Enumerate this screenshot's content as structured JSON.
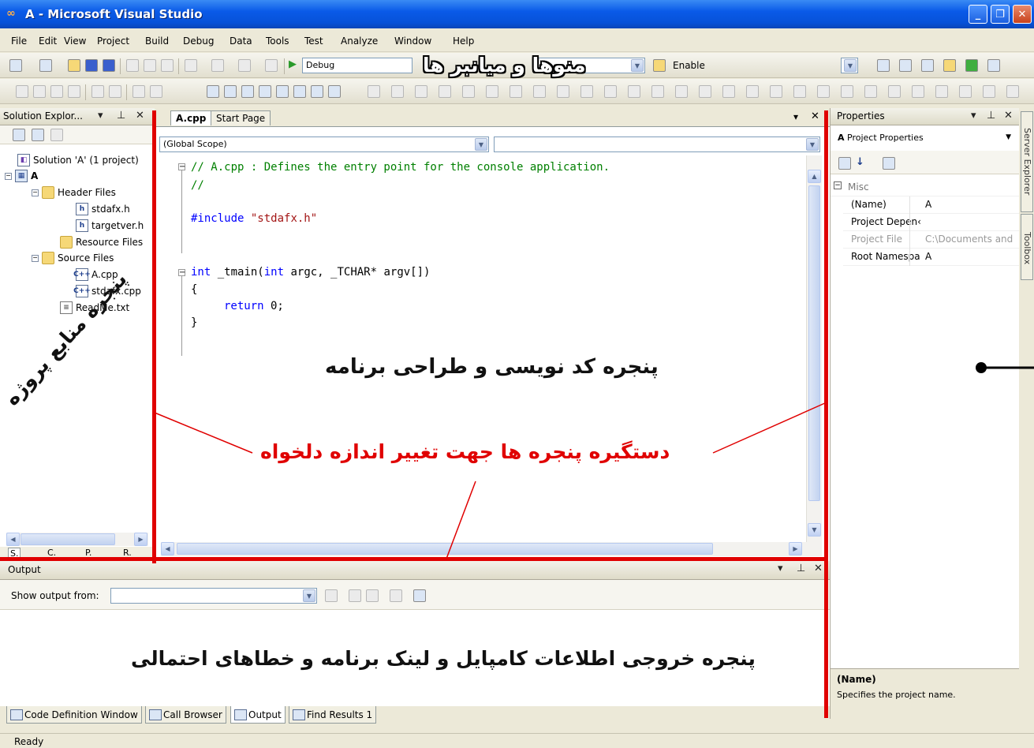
{
  "window": {
    "title": "A - Microsoft Visual Studio"
  },
  "menu": [
    "File",
    "Edit",
    "View",
    "Project",
    "Build",
    "Debug",
    "Data",
    "Tools",
    "Test",
    "Analyze",
    "Window",
    "Help"
  ],
  "toolbar": {
    "config_label": "Debug",
    "enable_label": "Enable"
  },
  "solution_explorer": {
    "title": "Solution Explor...",
    "tree": [
      {
        "label": "Solution 'A' (1 project)",
        "icon": "solution-icon",
        "level": 0
      },
      {
        "label": "A",
        "icon": "project-icon",
        "level": 0
      },
      {
        "label": "Header Files",
        "icon": "folder-icon",
        "level": 1
      },
      {
        "label": "stdafx.h",
        "icon": "header-file-icon",
        "level": 2
      },
      {
        "label": "targetver.h",
        "icon": "header-file-icon",
        "level": 2
      },
      {
        "label": "Resource Files",
        "icon": "folder-icon",
        "level": 1
      },
      {
        "label": "Source Files",
        "icon": "folder-icon",
        "level": 1
      },
      {
        "label": "A.cpp",
        "icon": "cpp-file-icon",
        "level": 2
      },
      {
        "label": "stdafx.cpp",
        "icon": "cpp-file-icon",
        "level": 2
      },
      {
        "label": "ReadMe.txt",
        "icon": "text-file-icon",
        "level": 1
      }
    ],
    "bottom_tabs": [
      "S.",
      "C.",
      "P.",
      "R."
    ]
  },
  "editor": {
    "tabs": [
      "A.cpp",
      "Start Page"
    ],
    "scope": "(Global Scope)",
    "member": "",
    "code": {
      "line1": "// A.cpp : Defines the entry point for the console application.",
      "line2": "//",
      "include_kw": "#include",
      "include_file": "\"stdafx.h\"",
      "main_int": "int",
      "main_rest": " _tmain(",
      "main_int2": "int",
      "main_args": " argc, _TCHAR* argv[])",
      "brace_open": "{",
      "return_kw": "return",
      "return_val": " 0;",
      "brace_close": "}"
    }
  },
  "properties": {
    "title": "Properties",
    "selector": "Project Properties",
    "selector_bold": "A",
    "category": "Misc",
    "rows": [
      {
        "name": "(Name)",
        "value": "A",
        "disabled": false
      },
      {
        "name": "Project Depen‹",
        "value": "",
        "disabled": false
      },
      {
        "name": "Project File",
        "value": "C:\\Documents and",
        "disabled": true
      },
      {
        "name": "Root Namespa",
        "value": "A",
        "disabled": false
      }
    ],
    "desc_title": "(Name)",
    "desc_text": "Specifies the project name."
  },
  "side_tabs": [
    "Server Explorer",
    "Toolbox"
  ],
  "output": {
    "title": "Output",
    "show_from_label": "Show output from:",
    "bottom_tabs": [
      "Code Definition Window",
      "Call Browser",
      "Output",
      "Find Results 1"
    ]
  },
  "status": {
    "text": "Ready"
  },
  "annotations": {
    "menus_toolbars": "منوها و میانبر ها",
    "code_window": "پنجره کد نویسی و طراحی برنامه",
    "resize_handles": "دستگیره پنجره ها جهت تغییر اندازه دلخواه",
    "project_resources": "پنجره منابع پروژه",
    "output_window": "پنجره خروجی اطلاعات کامپایل و لینک برنامه و خطاهای احتمالی"
  },
  "colors": {
    "annotation_red": "#e00000",
    "keyword": "#0000ff",
    "comment": "#008000",
    "string": "#a31515"
  }
}
